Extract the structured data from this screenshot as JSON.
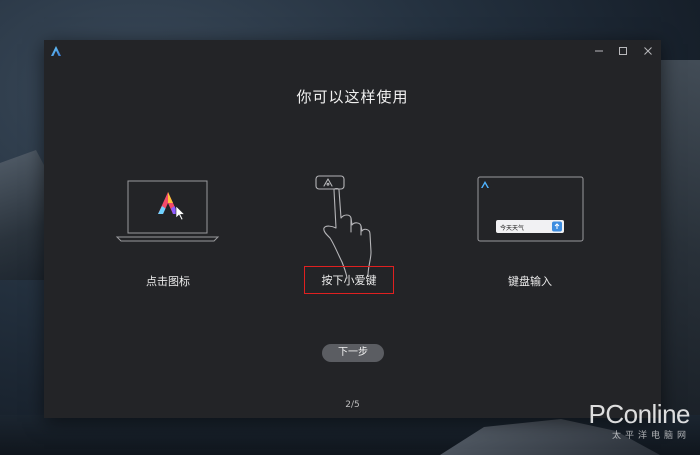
{
  "window": {
    "heading": "你可以这样使用",
    "pager": "2/5",
    "next_button": "下一步",
    "controls": [
      "minimize-icon",
      "maximize-icon",
      "close-icon"
    ]
  },
  "options": [
    {
      "label": "点击图标",
      "illustration": "laptop-with-logo-and-cursor",
      "selected": false
    },
    {
      "label": "按下小爱键",
      "illustration": "finger-pressing-key",
      "selected": true
    },
    {
      "label": "键盘输入",
      "illustration": "keyboard-input-box",
      "selected": false
    }
  ],
  "input_demo": {
    "text": "今天天气"
  },
  "watermark": {
    "main": "PConline",
    "sub": "太平洋电脑网"
  },
  "colors": {
    "window_bg": "#232427",
    "highlight_border": "#e02020",
    "button_bg": "#5b5d62",
    "send_button": "#3d8de0"
  }
}
